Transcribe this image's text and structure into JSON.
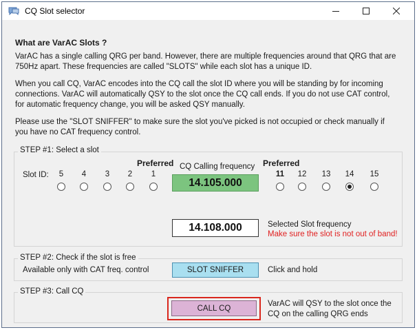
{
  "window": {
    "title": "CQ Slot selector",
    "controls": {
      "minimize_icon": "minimize-icon",
      "maximize_icon": "maximize-icon",
      "close_icon": "close-icon"
    }
  },
  "intro": {
    "heading": "What are VarAC Slots ?",
    "para1_line1": "VarAC has a single calling QRG per band. However, there are multiple frequencies around that QRG that are",
    "para1_line2": "750Hz apart. These frequencies are called \"SLOTS\" while each slot has a unique ID.",
    "para2_line1": "When you call CQ, VarAC encodes into the CQ call the slot ID where you will be standing by for incoming",
    "para2_line2": "connections. VarAC will automatically QSY to the slot once the CQ call ends. If you do not use CAT control,",
    "para2_line3": "for automatic frequency change, you will be asked QSY manually.",
    "para3_line1": "Please use the \"SLOT SNIFFER\" to make sure the slot you've picked is not occupied or check manually if",
    "para3_line2": "you have no CAT frequency control."
  },
  "step1": {
    "label": "STEP #1: Select a slot",
    "slot_id_label": "Slot ID:",
    "preferred_left": "Preferred",
    "preferred_right": "Preferred",
    "calling_label": "CQ Calling frequency",
    "calling_freq": "14.105.000",
    "slots_left": [
      "5",
      "4",
      "3",
      "2",
      "1"
    ],
    "slots_right": [
      "11",
      "12",
      "13",
      "14",
      "15"
    ],
    "selected_slot": "14",
    "selected_freq": "14.108.000",
    "selected_freq_label": "Selected Slot frequency",
    "warning": "Make sure the slot is not out of band!"
  },
  "step2": {
    "label": "STEP #2: Check if the slot is free",
    "note": "Available only with CAT freq. control",
    "sniffer_button": "SLOT SNIFFER",
    "hint": "Click and hold"
  },
  "step3": {
    "label": "STEP #3: Call CQ",
    "call_button": "CALL CQ",
    "note_line1": "VarAC will QSY to the slot once the",
    "note_line2": "CQ on the calling QRG ends"
  },
  "colors": {
    "calling_freq_bg": "#7cc47f",
    "sniffer_bg": "#a9dff0",
    "call_bg": "#dcb3d6",
    "highlight_border": "#d9261c",
    "warning": "#e02020"
  }
}
